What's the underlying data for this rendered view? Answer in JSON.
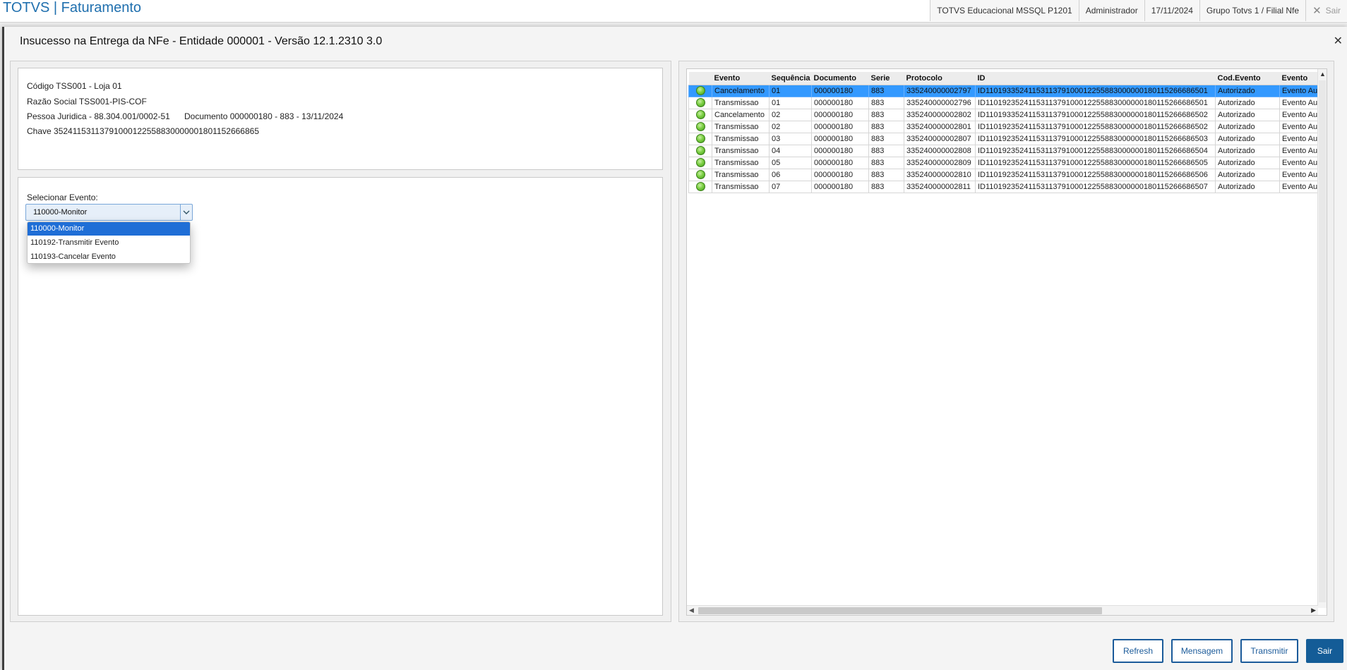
{
  "app": {
    "title": "TOTVS | Faturamento"
  },
  "status_bar": {
    "environment": "TOTVS Educacional MSSQL P1201",
    "user": "Administrador",
    "date": "17/11/2024",
    "branch": "Grupo Totvs 1 / Filial Nfe",
    "exit_label": "Sair"
  },
  "dialog": {
    "title": "Insucesso na Entrega da NFe - Entidade 000001 - Versão 12.1.2310  3.0",
    "info": {
      "codigo": "Código TSS001 - Loja 01",
      "razao": "Razão Social TSS001-PIS-COF",
      "pessoa": "Pessoa Juridica - 88.304.001/0002-51",
      "documento": "Documento 000000180 - 883 - 13/11/2024",
      "chave": "Chave 35241153113791000122558830000001801152666865"
    },
    "event_select": {
      "label": "Selecionar Evento:",
      "value": "110000-Monitor",
      "options": [
        "110000-Monitor",
        "110192-Transmitir Evento",
        "110193-Cancelar Evento"
      ]
    },
    "grid": {
      "columns": [
        "",
        "Evento",
        "Sequência",
        "Documento",
        "Serie",
        "Protocolo",
        "ID",
        "Cod.Evento",
        "Evento"
      ],
      "rows": [
        {
          "evento": "Cancelamento",
          "seq": "01",
          "doc": "000000180",
          "serie": "883",
          "protocolo": "335240000002797",
          "id": "ID1101933524115311379100012255883000000180115266686501",
          "cod": "Autorizado",
          "evento2": "Evento Autorizado"
        },
        {
          "evento": "Transmissao",
          "seq": "01",
          "doc": "000000180",
          "serie": "883",
          "protocolo": "335240000002796",
          "id": "ID1101923524115311379100012255883000000180115266686501",
          "cod": "Autorizado",
          "evento2": "Evento Autorizado"
        },
        {
          "evento": "Cancelamento",
          "seq": "02",
          "doc": "000000180",
          "serie": "883",
          "protocolo": "335240000002802",
          "id": "ID1101933524115311379100012255883000000180115266686502",
          "cod": "Autorizado",
          "evento2": "Evento Autorizado"
        },
        {
          "evento": "Transmissao",
          "seq": "02",
          "doc": "000000180",
          "serie": "883",
          "protocolo": "335240000002801",
          "id": "ID1101923524115311379100012255883000000180115266686502",
          "cod": "Autorizado",
          "evento2": "Evento Autorizado"
        },
        {
          "evento": "Transmissao",
          "seq": "03",
          "doc": "000000180",
          "serie": "883",
          "protocolo": "335240000002807",
          "id": "ID1101923524115311379100012255883000000180115266686503",
          "cod": "Autorizado",
          "evento2": "Evento Autorizado"
        },
        {
          "evento": "Transmissao",
          "seq": "04",
          "doc": "000000180",
          "serie": "883",
          "protocolo": "335240000002808",
          "id": "ID1101923524115311379100012255883000000180115266686504",
          "cod": "Autorizado",
          "evento2": "Evento Autorizado"
        },
        {
          "evento": "Transmissao",
          "seq": "05",
          "doc": "000000180",
          "serie": "883",
          "protocolo": "335240000002809",
          "id": "ID1101923524115311379100012255883000000180115266686505",
          "cod": "Autorizado",
          "evento2": "Evento Autorizado"
        },
        {
          "evento": "Transmissao",
          "seq": "06",
          "doc": "000000180",
          "serie": "883",
          "protocolo": "335240000002810",
          "id": "ID1101923524115311379100012255883000000180115266686506",
          "cod": "Autorizado",
          "evento2": "Evento Autorizado"
        },
        {
          "evento": "Transmissao",
          "seq": "07",
          "doc": "000000180",
          "serie": "883",
          "protocolo": "335240000002811",
          "id": "ID1101923524115311379100012255883000000180115266686507",
          "cod": "Autorizado",
          "evento2": "Evento Autorizado"
        }
      ]
    },
    "buttons": {
      "refresh": "Refresh",
      "mensagem": "Mensagem",
      "transmitir": "Transmitir",
      "sair": "Sair"
    }
  },
  "colors": {
    "brand": "#1f6fae",
    "selected_row": "#3399ff",
    "dropdown_active": "#1f6ed6",
    "button_primary": "#145c97"
  },
  "icons": {
    "status": "green-status-icon",
    "close": "close-icon",
    "combo": "chevron-down-icon"
  }
}
